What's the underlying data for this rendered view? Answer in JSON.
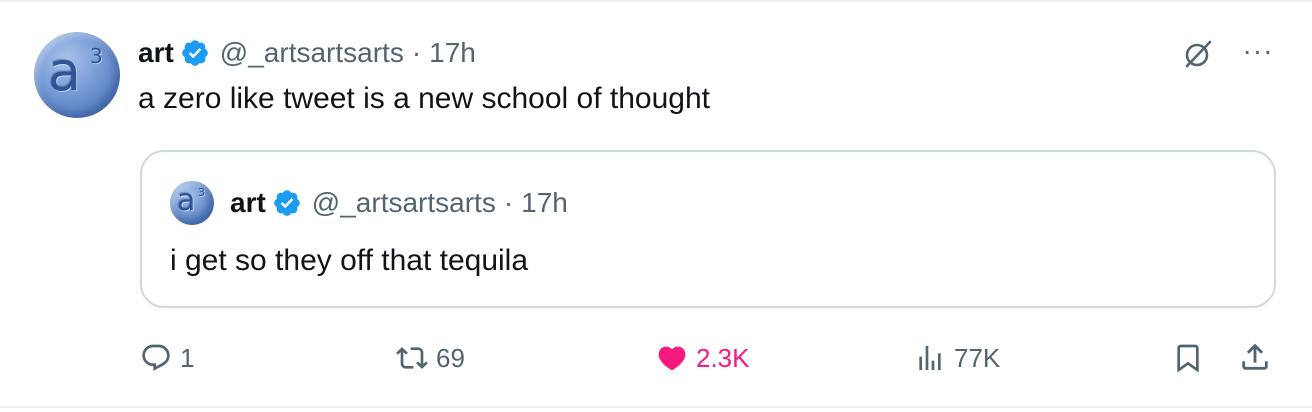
{
  "tweet": {
    "author": {
      "name": "art",
      "handle": "@_artsartsarts",
      "avatar_glyph": "a",
      "avatar_sup": "3"
    },
    "separator": "·",
    "time": "17h",
    "text": "a zero like tweet is a new school of thought",
    "menu_glyph": "···",
    "quote": {
      "author": {
        "name": "art",
        "handle": "@_artsartsarts",
        "avatar_glyph": "a",
        "avatar_sup": "3"
      },
      "separator": "·",
      "time": "17h",
      "text": "i get so they off that tequila"
    },
    "actions": {
      "reply_count": "1",
      "retweet_count": "69",
      "like_count": "2.3K",
      "views_count": "77K"
    }
  },
  "icons": {
    "verified": "verified-badge-icon",
    "grok": "grok-icon",
    "more": "more-icon",
    "reply": "reply-icon",
    "retweet": "retweet-icon",
    "like": "heart-icon",
    "views": "views-icon",
    "bookmark": "bookmark-icon",
    "share": "share-icon"
  },
  "colors": {
    "verified": "#1d9bf0",
    "like": "#f91880",
    "secondary_text": "#536471",
    "primary_text": "#0f1419",
    "border": "#cfd9de"
  }
}
